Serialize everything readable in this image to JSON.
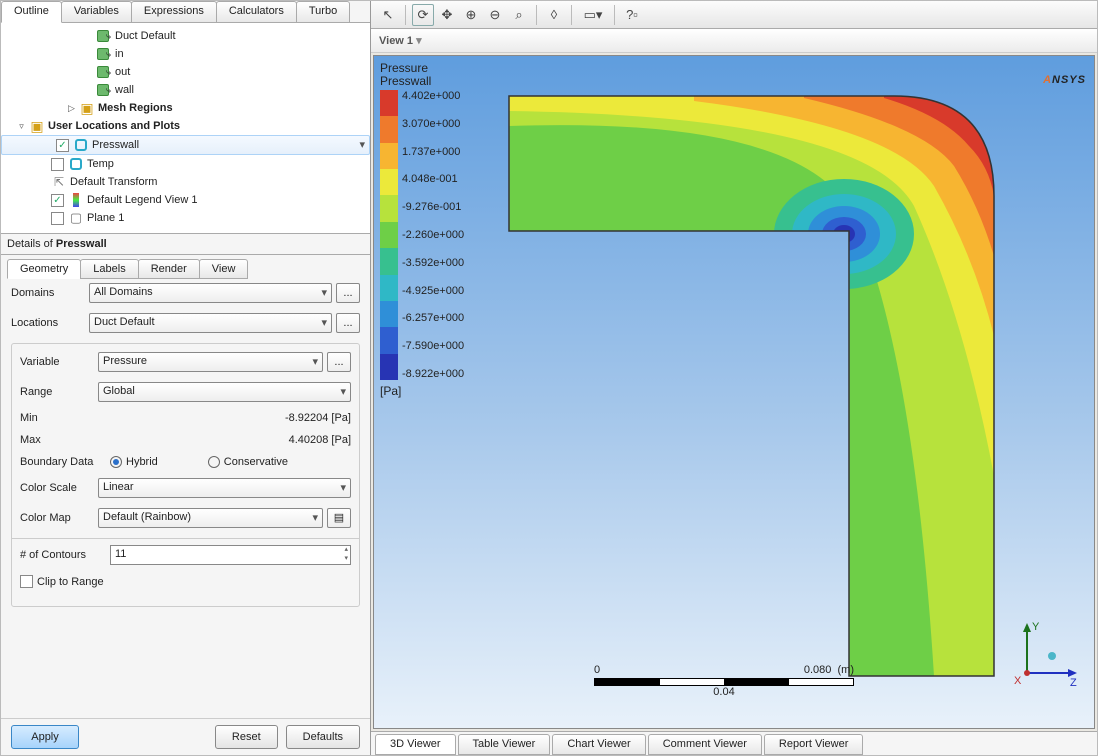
{
  "topTabs": [
    "Outline",
    "Variables",
    "Expressions",
    "Calculators",
    "Turbo"
  ],
  "tree": {
    "items": [
      {
        "indent": 95,
        "cb": false,
        "checked": false,
        "icon": "region",
        "label": "Duct Default"
      },
      {
        "indent": 95,
        "cb": false,
        "checked": false,
        "icon": "region",
        "label": "in"
      },
      {
        "indent": 95,
        "cb": false,
        "checked": false,
        "icon": "region",
        "label": "out"
      },
      {
        "indent": 95,
        "cb": false,
        "checked": false,
        "icon": "region",
        "label": "wall"
      },
      {
        "indent": 65,
        "expander": "▷",
        "icon": "fold",
        "label": "Mesh Regions",
        "bold": true
      },
      {
        "indent": 15,
        "expander": "▿",
        "icon": "fold",
        "label": "User Locations and Plots",
        "bold": true
      },
      {
        "indent": 50,
        "cb": true,
        "checked": true,
        "icon": "press",
        "label": "Presswall",
        "sel": true
      },
      {
        "indent": 50,
        "cb": true,
        "checked": false,
        "icon": "press",
        "label": "Temp"
      },
      {
        "indent": 50,
        "icon": "transform",
        "label": "Default Transform"
      },
      {
        "indent": 50,
        "cb": true,
        "checked": true,
        "icon": "legend",
        "label": "Default Legend View 1"
      },
      {
        "indent": 50,
        "cb": true,
        "checked": false,
        "icon": "plane",
        "label": "Plane 1"
      }
    ]
  },
  "details": {
    "title": "Details of ",
    "titleBold": "Presswall",
    "tabs": [
      "Geometry",
      "Labels",
      "Render",
      "View"
    ],
    "domains_lbl": "Domains",
    "domains_val": "All Domains",
    "locations_lbl": "Locations",
    "locations_val": "Duct Default",
    "variable_lbl": "Variable",
    "variable_val": "Pressure",
    "range_lbl": "Range",
    "range_val": "Global",
    "min_lbl": "Min",
    "min_val": "-8.92204 [Pa]",
    "max_lbl": "Max",
    "max_val": "4.40208 [Pa]",
    "boundary_lbl": "Boundary Data",
    "hybrid": "Hybrid",
    "conservative": "Conservative",
    "colorscale_lbl": "Color Scale",
    "colorscale_val": "Linear",
    "colormap_lbl": "Color Map",
    "colormap_val": "Default (Rainbow)",
    "contours_lbl": "# of Contours",
    "contours_val": "11",
    "clip_lbl": "Clip to Range",
    "apply": "Apply",
    "reset": "Reset",
    "defaults": "Defaults"
  },
  "view": {
    "label": "View 1",
    "legend_title1": "Pressure",
    "legend_title2": "Presswall",
    "legend_vals": [
      "4.402e+000",
      "3.070e+000",
      "1.737e+000",
      "4.048e-001",
      "-9.276e-001",
      "-2.260e+000",
      "-3.592e+000",
      "-4.925e+000",
      "-6.257e+000",
      "-7.590e+000",
      "-8.922e+000"
    ],
    "legend_colors": [
      "#d83a2b",
      "#ef7a2c",
      "#f7b531",
      "#ece93a",
      "#b7e23c",
      "#6ecf47",
      "#37c08f",
      "#2fb8c6",
      "#2f8fd8",
      "#2f5fd0",
      "#2734b4"
    ],
    "legend_unit": "[Pa]",
    "scale_0": "0",
    "scale_right": "0.080",
    "scale_unit": "(m)",
    "scale_mid": "0.04",
    "axes": {
      "y": "Y",
      "z": "Z",
      "x": "X"
    }
  },
  "bottomTabs": [
    "3D Viewer",
    "Table Viewer",
    "Chart Viewer",
    "Comment Viewer",
    "Report Viewer"
  ],
  "brand": "NSYS",
  "brandA": "A"
}
